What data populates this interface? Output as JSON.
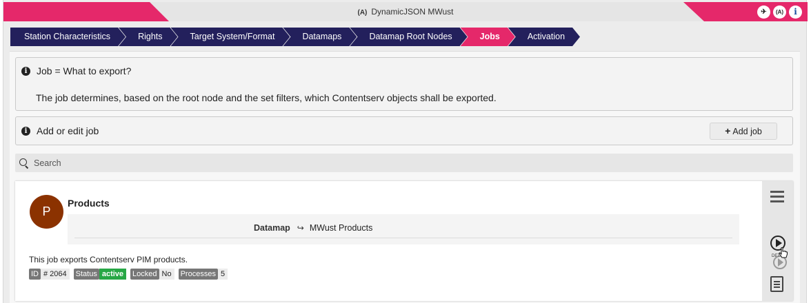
{
  "titlebar": {
    "title": "DynamicJSON MWust",
    "antenna_glyph": "(A)",
    "icons": [
      "airplane-icon",
      "antenna-icon",
      "info-icon"
    ]
  },
  "steps": [
    {
      "label": "Station Characteristics",
      "active": false
    },
    {
      "label": "Rights",
      "active": false
    },
    {
      "label": "Target System/Format",
      "active": false
    },
    {
      "label": "Datamaps",
      "active": false
    },
    {
      "label": "Datamap Root Nodes",
      "active": false
    },
    {
      "label": "Jobs",
      "active": true
    },
    {
      "label": "Activation",
      "active": false
    }
  ],
  "info_what": {
    "heading": "Job = What to export?",
    "description": "The job determines, based on the root node and the set filters, which Contentserv objects shall be exported."
  },
  "info_edit": {
    "heading": "Add or edit job",
    "add_button": "Add job"
  },
  "search": {
    "placeholder": "Search"
  },
  "job": {
    "avatar_letter": "P",
    "title": "Products",
    "datamap_label": "Datamap",
    "datamap_value": "MWust Products",
    "description": "This job exports Contentserv PIM products.",
    "badges": {
      "id_key": "ID",
      "id_value": "# 2064",
      "status_key": "Status",
      "status_value": "active",
      "locked_key": "Locked",
      "locked_value": "No",
      "processes_key": "Processes",
      "processes_value": "5"
    },
    "side_label": "DET"
  },
  "colors": {
    "accent_pink": "#e5286a",
    "nav_dark": "#23205c",
    "avatar_brown": "#8b3200",
    "status_green": "#27a745"
  }
}
